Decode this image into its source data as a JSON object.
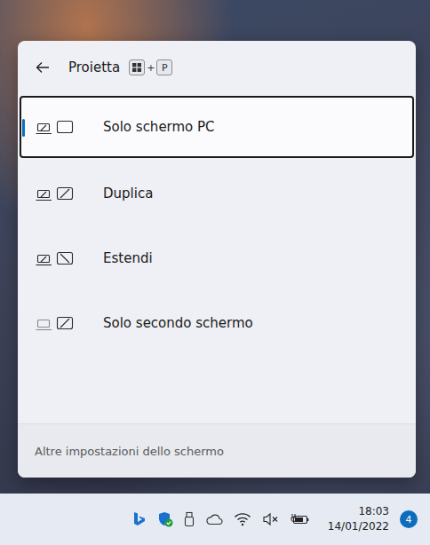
{
  "flyout": {
    "title": "Proietta",
    "shortcut": {
      "plus": "+",
      "key": "P"
    },
    "options": [
      {
        "label": "Solo schermo PC",
        "selected": true
      },
      {
        "label": "Duplica",
        "selected": false
      },
      {
        "label": "Estendi",
        "selected": false
      },
      {
        "label": "Solo secondo schermo",
        "selected": false
      }
    ],
    "footer": "Altre impostazioni dello schermo"
  },
  "taskbar": {
    "sound_muted": true,
    "time": "18:03",
    "date": "14/01/2022",
    "notifications": "4"
  }
}
